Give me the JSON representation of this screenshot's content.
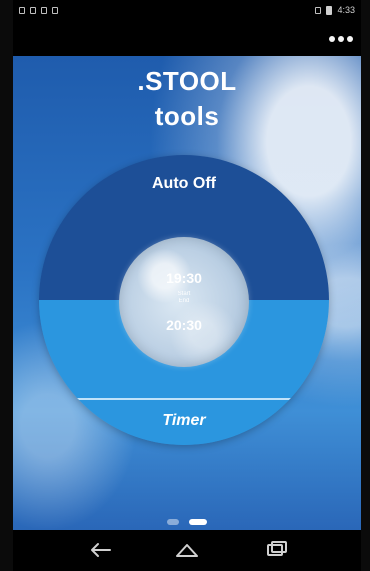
{
  "app": {
    "title_line1": ".STOOL",
    "title_line2": "tools"
  },
  "dial": {
    "top_label": "Auto Off",
    "bottom_label": "Timer",
    "time_top": "19:30",
    "time_bottom": "20:30",
    "tiny_line1": "Start",
    "tiny_line2": "End"
  },
  "status_bar": {
    "time": "4:33"
  },
  "icons": {
    "overflow": "more-dots-icon",
    "back": "back-icon",
    "home": "home-icon",
    "recents": "recents-icon"
  },
  "pager": {
    "pages": 2,
    "active_index": 1
  }
}
